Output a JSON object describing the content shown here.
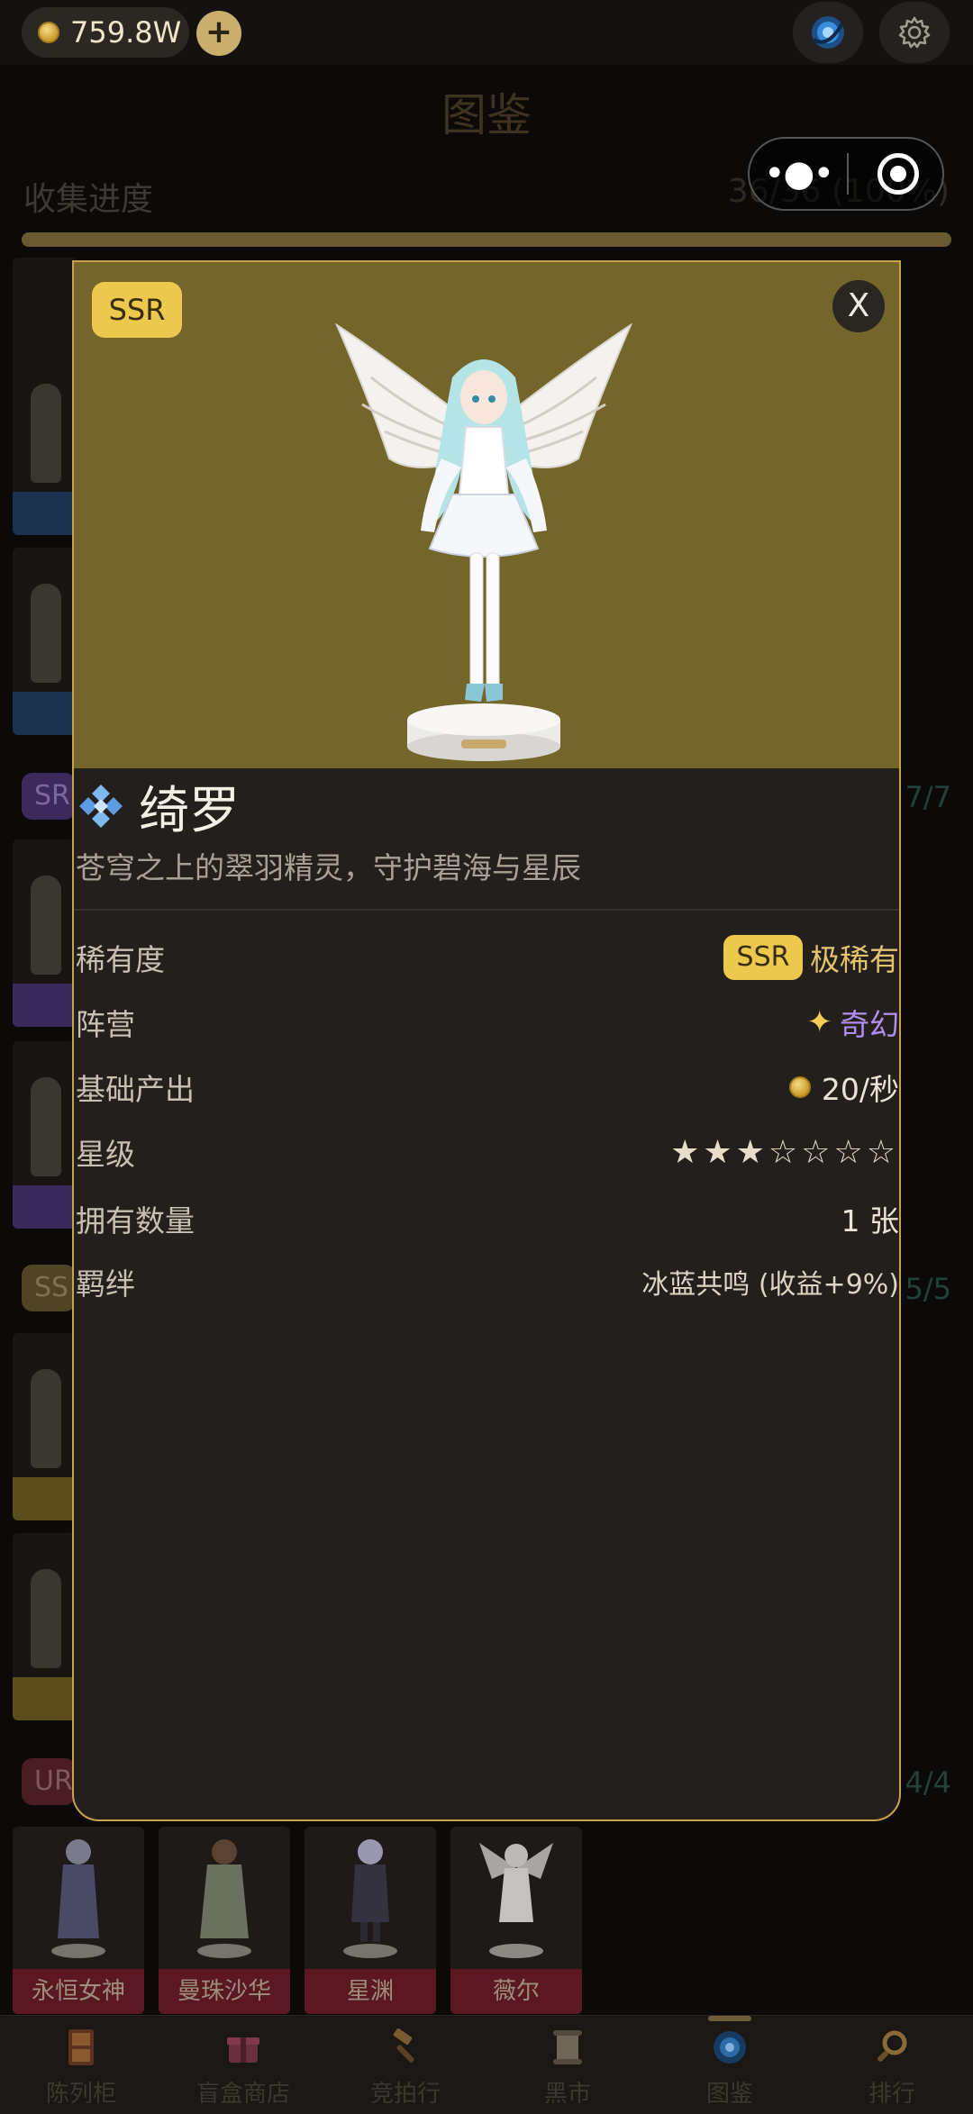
{
  "topbar": {
    "coins": "759.8W",
    "plus": "+"
  },
  "page": {
    "title": "图鉴",
    "progress_label": "收集进度",
    "progress_count": "36/36 (100%)",
    "progress_fraction": 1.0
  },
  "sections": [
    {
      "tag": "SR",
      "count": "7/7"
    },
    {
      "tag": "SS",
      "count": "5/5"
    },
    {
      "tag": "UR",
      "count": "4/4"
    }
  ],
  "ur_cards": [
    {
      "name": "永恒女神"
    },
    {
      "name": "曼珠沙华"
    },
    {
      "name": "星渊"
    },
    {
      "name": "薇尔"
    }
  ],
  "modal": {
    "rarity": "SSR",
    "close": "X",
    "name": "绮罗",
    "description": "苍穹之上的翠羽精灵，守护碧海与星辰",
    "stats": {
      "rarity_label": "稀有度",
      "rarity_chip": "SSR",
      "rarity_value": "极稀有",
      "faction_label": "阵营",
      "faction_value": "奇幻",
      "output_label": "基础产出",
      "output_value": "20/秒",
      "star_label": "星级",
      "stars": "★★★☆☆☆☆",
      "stars_filled": 3,
      "stars_total": 7,
      "owned_label": "拥有数量",
      "owned_value": "1 张",
      "bond_label": "羁绊",
      "bond_value": "冰蓝共鸣 (收益+9%)"
    }
  },
  "nav": [
    {
      "label": "陈列柜",
      "icon": "cabinet-icon"
    },
    {
      "label": "盲盒商店",
      "icon": "gift-box-icon"
    },
    {
      "label": "竞拍行",
      "icon": "gavel-icon"
    },
    {
      "label": "黑市",
      "icon": "scroll-icon"
    },
    {
      "label": "图鉴",
      "icon": "portal-icon",
      "active": true
    },
    {
      "label": "排行",
      "icon": "magnifier-icon"
    }
  ],
  "colors": {
    "accent": "#c9a24e",
    "ssr": "#ecc94c",
    "ur": "#5b1822",
    "hero_bg": "#74652a"
  }
}
